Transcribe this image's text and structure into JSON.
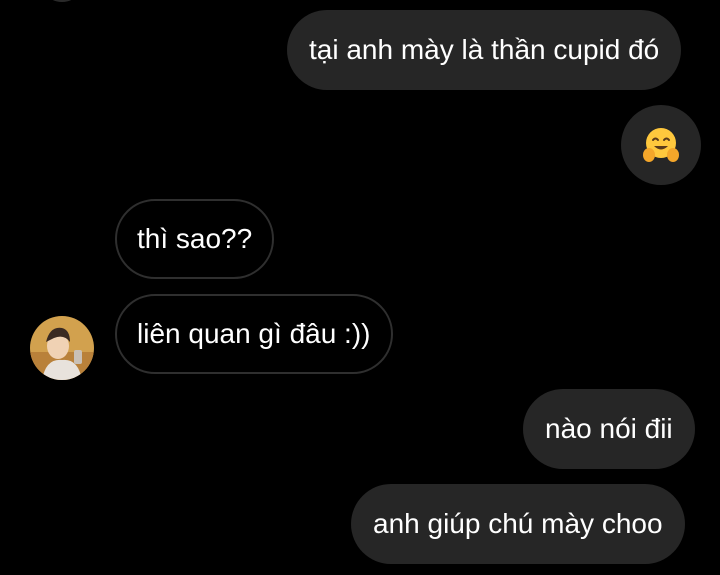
{
  "messages": [
    {
      "direction": "outgoing",
      "text": "tại anh mày là thần cupid đó"
    },
    {
      "direction": "outgoing",
      "type": "emoji",
      "emoji": "hugging-face-emoji"
    },
    {
      "direction": "incoming",
      "text": "thì sao??"
    },
    {
      "direction": "incoming",
      "text": "liên quan gì đâu :))"
    },
    {
      "direction": "outgoing",
      "text": "nào nói đii"
    },
    {
      "direction": "outgoing",
      "text": "anh giúp chú mày choo"
    }
  ],
  "colors": {
    "background": "#000000",
    "outgoing_bubble": "#262626",
    "incoming_border": "#2f2f2f",
    "text": "#ffffff"
  }
}
